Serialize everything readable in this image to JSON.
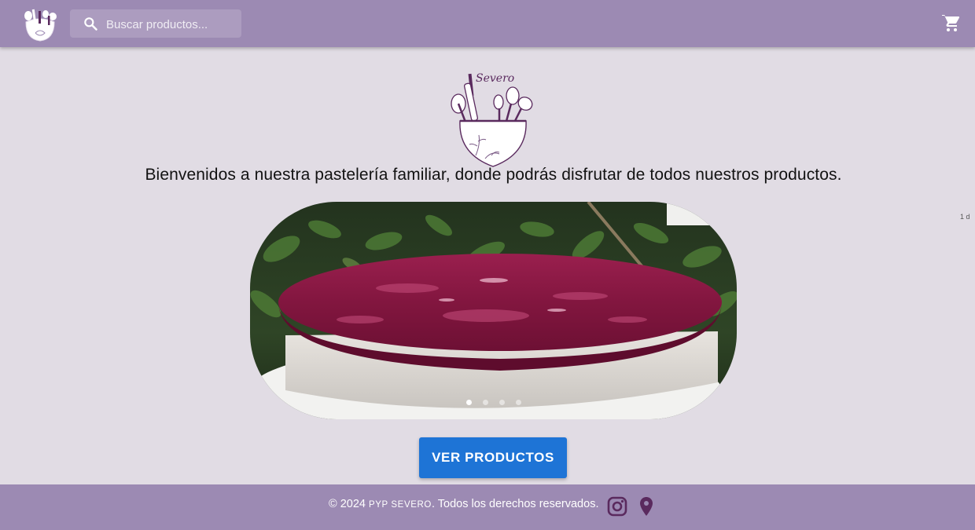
{
  "header": {
    "logo_text": "Severo",
    "search_placeholder": "Buscar productos...",
    "icons": {
      "logo": "pastry-utensils-logo",
      "search": "search-icon",
      "cart": "shopping-cart-icon"
    }
  },
  "hero": {
    "logo_text": "Severo",
    "welcome": "Bienvenidos a nuestra pastelería familiar, donde podrás disfrutar de todos nuestros productos.",
    "carousel": {
      "slide_count": 4,
      "active_index": 0,
      "image": "cake-with-berry-jelly-photo"
    },
    "side_marker": "1 d",
    "cta_label": "VER PRODUCTOS"
  },
  "footer": {
    "copyright_prefix": "© 2024",
    "brand": "PYP SEVERO",
    "copyright_suffix": ". Todos los derechos reservados.",
    "icons": {
      "instagram": "instagram-icon",
      "location": "map-pin-icon"
    }
  },
  "colors": {
    "topbar": "#9c8ab3",
    "background": "#e1dce4",
    "cta": "#1e74d6",
    "accent_purple": "#5a2a5e"
  }
}
